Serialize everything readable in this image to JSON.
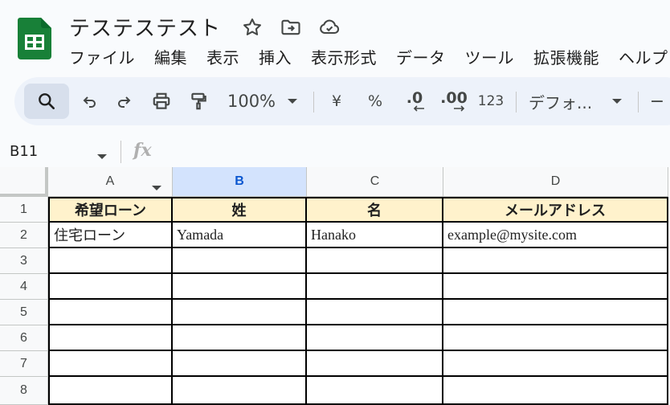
{
  "app": {
    "doc_title": "テステステスト",
    "menu": [
      "ファイル",
      "編集",
      "表示",
      "挿入",
      "表示形式",
      "データ",
      "ツール",
      "拡張機能",
      "ヘルプ"
    ]
  },
  "toolbar": {
    "zoom": "100%",
    "currency": "¥",
    "percent": "%",
    "decimal_decrease": ".0",
    "decimal_increase": ".00",
    "number_format": "123",
    "font": "デフォ...",
    "font_size_minus": "−"
  },
  "formula_bar": {
    "name_box": "B11",
    "fx": "fx"
  },
  "sheet": {
    "columns": [
      "A",
      "B",
      "C",
      "D"
    ],
    "selected_column": "B",
    "rows": [
      "1",
      "2",
      "3",
      "4",
      "5",
      "6",
      "7",
      "8"
    ],
    "header_row": [
      "希望ローン",
      "姓",
      "名",
      "メールアドレス"
    ],
    "data_row": [
      "住宅ローン",
      "Yamada",
      "Hanako",
      "example@mysite.com"
    ],
    "header_fill": "#fff2cc"
  }
}
